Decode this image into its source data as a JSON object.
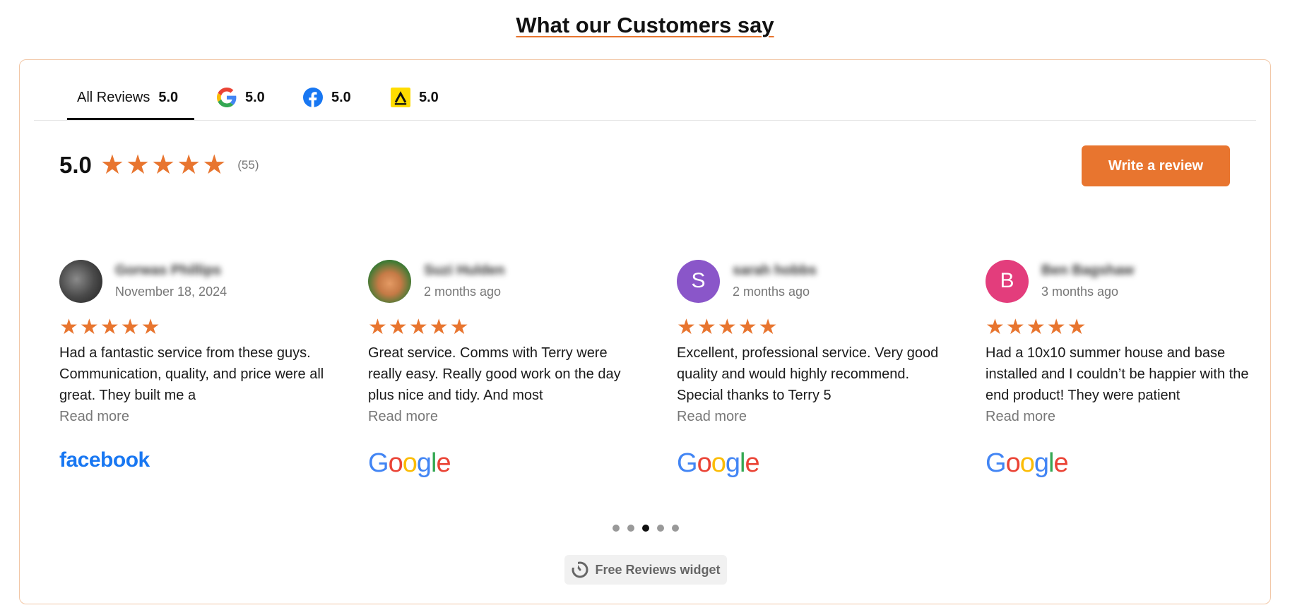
{
  "title": "What our Customers say",
  "tabs": [
    {
      "label": "All Reviews",
      "score": "5.0",
      "icon": "all-reviews",
      "active": true
    },
    {
      "label": "",
      "score": "5.0",
      "icon": "google-icon"
    },
    {
      "label": "",
      "score": "5.0",
      "icon": "facebook-icon"
    },
    {
      "label": "",
      "score": "5.0",
      "icon": "yell-icon"
    }
  ],
  "summary": {
    "score": "5.0",
    "rating": 5,
    "count": "(55)"
  },
  "write_review_label": "Write a review",
  "colors": {
    "accent": "#e8752f",
    "facebook": "#1877f2"
  },
  "reviews": [
    {
      "name": "Gorwas Phillips",
      "date": "November 18, 2024",
      "rating": 5,
      "text": "Had a fantastic service from these guys. Communication, quality, and price were all great. They built me a",
      "read_more": "Read more",
      "source": "facebook",
      "source_label": "facebook",
      "avatar": "photo"
    },
    {
      "name": "Suzi Hulden",
      "date": "2 months ago",
      "rating": 5,
      "text": "Great service. Comms with Terry were really easy. Really good work on the day plus nice and tidy. And most",
      "read_more": "Read more",
      "source": "google",
      "source_label": "Google",
      "avatar": "photo"
    },
    {
      "name": "sarah hobbs",
      "date": "2 months ago",
      "rating": 5,
      "text": "Excellent, professional service. Very good quality and would highly recommend. Special thanks to Terry 5",
      "read_more": "Read more",
      "source": "google",
      "source_label": "Google",
      "avatar": "S"
    },
    {
      "name": "Ben Bagshaw",
      "date": "3 months ago",
      "rating": 5,
      "text": "Had a 10x10 summer house and base installed and I couldn’t be happier with the end product! They were patient",
      "read_more": "Read more",
      "source": "google",
      "source_label": "Google",
      "avatar": "B"
    }
  ],
  "pagination": {
    "total": 5,
    "active_index": 3
  },
  "badge_label": "Free Reviews widget"
}
